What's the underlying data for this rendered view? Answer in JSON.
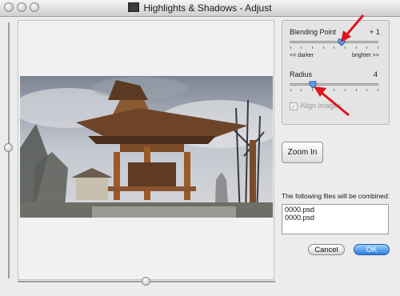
{
  "window": {
    "title": "Highlights & Shadows - Adjust",
    "title_icon": "photo-icon"
  },
  "controls": {
    "blending_point": {
      "label": "Blending Point",
      "value": "+ 1",
      "left_caption": "<< darker",
      "right_caption": "brighter >>",
      "level_fraction": 0.62
    },
    "radius": {
      "label": "Radius",
      "value": "4",
      "level_fraction": 0.25
    },
    "align_images": {
      "label": "Align images",
      "checked": true,
      "disabled": true
    },
    "zoom_in_label": "Zoom In"
  },
  "files": {
    "label": "The following files will be combined:",
    "items": [
      "0000.psd",
      "0000.psd"
    ]
  },
  "buttons": {
    "cancel": "Cancel",
    "ok": "OK"
  },
  "colors": {
    "accent_arrow": "#e0141e",
    "ok_button": "#2c7de0"
  }
}
